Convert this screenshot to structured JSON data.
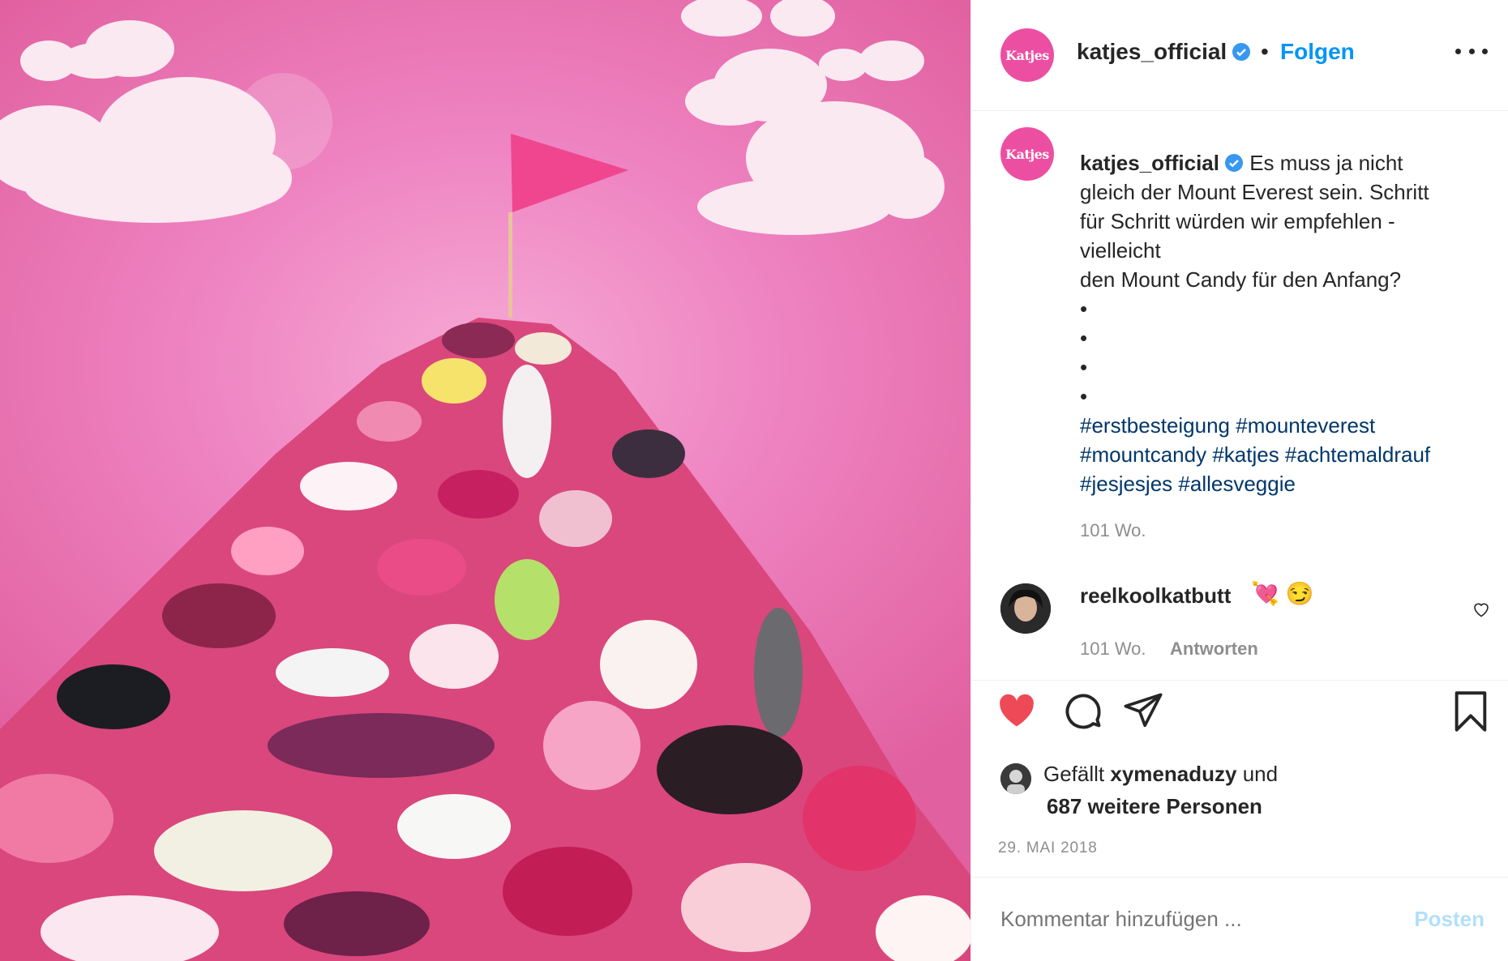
{
  "post": {
    "brand_avatar_text": "Katjes",
    "username": "katjes_official",
    "separator": "•",
    "follow_label": "Folgen",
    "caption_lines": [
      "Es muss ja nicht",
      "gleich der Mount Everest sein. Schritt",
      "für Schritt würden wir empfehlen -",
      "vielleicht",
      "den Mount Candy für den Anfang?"
    ],
    "caption_bullets": [
      "•",
      "•",
      "•",
      "•"
    ],
    "hashtag_lines": [
      "#erstbesteigung #mounteverest",
      "#mountcandy #katjes #achtemaldrauf",
      "#jesjesjes #allesveggie"
    ],
    "caption_time": "101 Wo."
  },
  "comment": {
    "username": "reelkoolkatbutt",
    "emojis": "💘 😏",
    "time": "101 Wo.",
    "reply_label": "Antworten"
  },
  "likes": {
    "prefix": "Gefällt",
    "liker": "xymenaduzy",
    "suffix": "und",
    "others": "687 weitere Personen"
  },
  "date": "29. MAI 2018",
  "compose": {
    "placeholder": "Kommentar hinzufügen ...",
    "post_label": "Posten"
  },
  "colors": {
    "link_blue": "#0095f6",
    "hashtag_blue": "#00376b",
    "like_red": "#ed4956",
    "brand_pink": "#ec4fa2"
  },
  "icons": [
    "verified-badge-icon",
    "more-options-icon",
    "heart-outline-icon",
    "heart-filled-icon",
    "comment-bubble-icon",
    "share-plane-icon",
    "bookmark-icon"
  ]
}
